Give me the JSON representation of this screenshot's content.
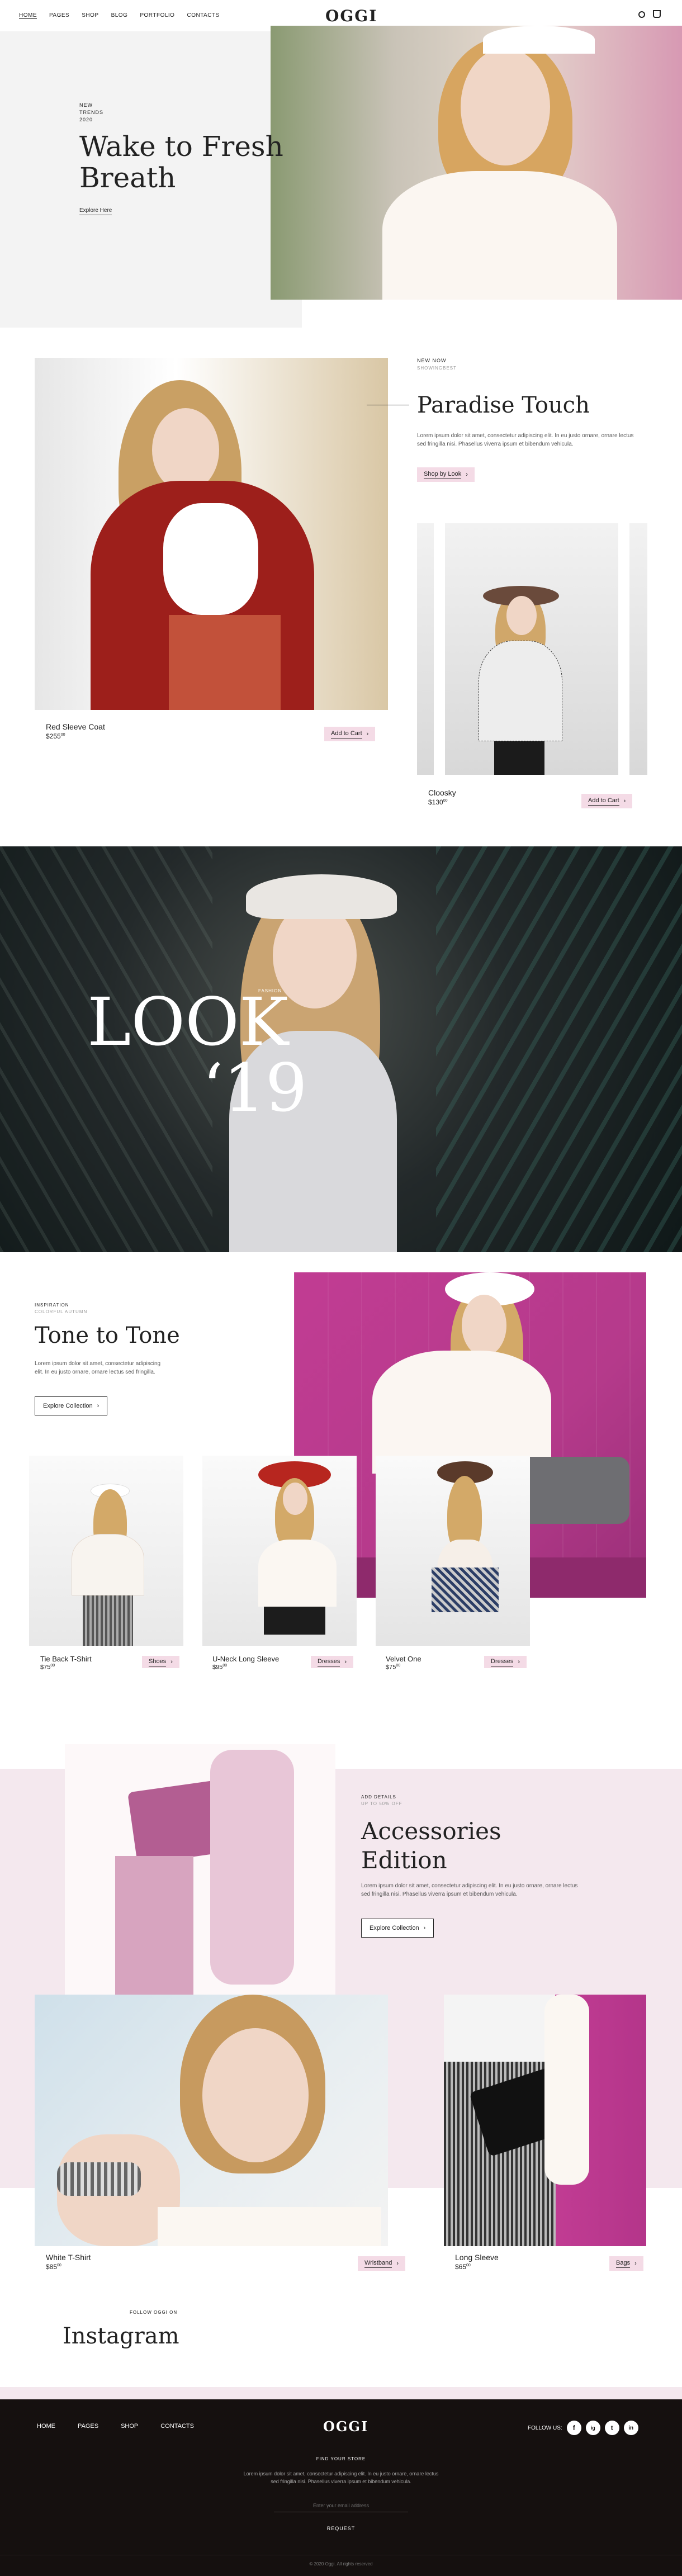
{
  "header": {
    "nav": [
      "HOME",
      "PAGES",
      "SHOP",
      "BLOG",
      "PORTFOLIO",
      "CONTACTS"
    ],
    "logo": "OGGI",
    "search_icon": "search-icon",
    "cart_icon": "cart-icon"
  },
  "hero": {
    "eyebrow_line1": "NEW",
    "eyebrow_line2": "TRENDS",
    "eyebrow_line3": "2020",
    "title_line1": "Wake to Fresh",
    "title_line2": "Breath",
    "link": "Explore Here"
  },
  "paradise": {
    "eyebrow": "NEW NOW",
    "sub": "SHOWINGBEST",
    "title": "Paradise Touch",
    "text": "Lorem ipsum dolor sit amet, consectetur adipiscing elit. In eu justo ornare, ornare lectus sed fringilla nisi. Phasellus viverra ipsum et bibendum vehicula.",
    "cta": "Shop by Look",
    "product1": {
      "name": "Red Sleeve Coat",
      "price": "$255",
      "cents": "00",
      "btn": "Add to Cart"
    },
    "product2": {
      "name": "Cloosky",
      "price": "$130",
      "cents": "00",
      "btn": "Add to Cart"
    }
  },
  "banner": {
    "small": "FASHION",
    "word": "LOOK",
    "year": "‘19"
  },
  "tone": {
    "eyebrow": "INSPIRATION",
    "sub": "COLORFUL AUTUMN",
    "title": "Tone to Tone",
    "text": "Lorem ipsum dolor sit amet, consectetur adipiscing elit. In eu justo ornare, ornare lectus sed fringilla.",
    "cta": "Explore Collection",
    "products": [
      {
        "name": "Tie Back T-Shirt",
        "price": "$75",
        "cents": "00",
        "btn": "Shoes"
      },
      {
        "name": "U-Neck Long Sleeve",
        "price": "$95",
        "cents": "00",
        "btn": "Dresses"
      },
      {
        "name": "Velvet One",
        "price": "$75",
        "cents": "00",
        "btn": "Dresses"
      }
    ]
  },
  "accessories": {
    "eyebrow": "ADD DETAILS",
    "sub": "UP TO 50% OFF",
    "title_line1": "Accessories",
    "title_line2": "Edition",
    "text": "Lorem ipsum dolor sit amet, consectetur adipiscing elit. In eu justo ornare, ornare lectus sed fringilla nisi. Phasellus viverra ipsum et bibendum vehicula.",
    "cta": "Explore Collection",
    "product1": {
      "name": "White T-Shirt",
      "price": "$85",
      "cents": "00",
      "btn": "Wristband"
    },
    "product2": {
      "name": "Long Sleeve",
      "price": "$65",
      "cents": "00",
      "btn": "Bags"
    }
  },
  "instagram": {
    "eyebrow": "FOLLOW OGGI ON",
    "title": "Instagram"
  },
  "footer": {
    "nav": [
      "HOME",
      "PAGES",
      "SHOP",
      "CONTACTS"
    ],
    "logo": "OGGI",
    "follow": "FOLLOW US:",
    "social": [
      "f",
      "ig",
      "t",
      "in"
    ],
    "find_title": "FIND YOUR STORE",
    "find_text_1": "Lorem ipsum dolor sit amet, consectetur adipiscing elit. In eu justo ornare, ornare lectus",
    "find_text_2": "sed fringilla nisi. Phasellus viverra ipsum et bibendum vehicula.",
    "email_placeholder": "Enter your email address",
    "request": "REQUEST",
    "copyright": "© 2020 Oggi. All rights reserved"
  },
  "colors": {
    "accent": "#f4dbe6",
    "dark": "#15100f",
    "magenta": "#c0569a"
  }
}
